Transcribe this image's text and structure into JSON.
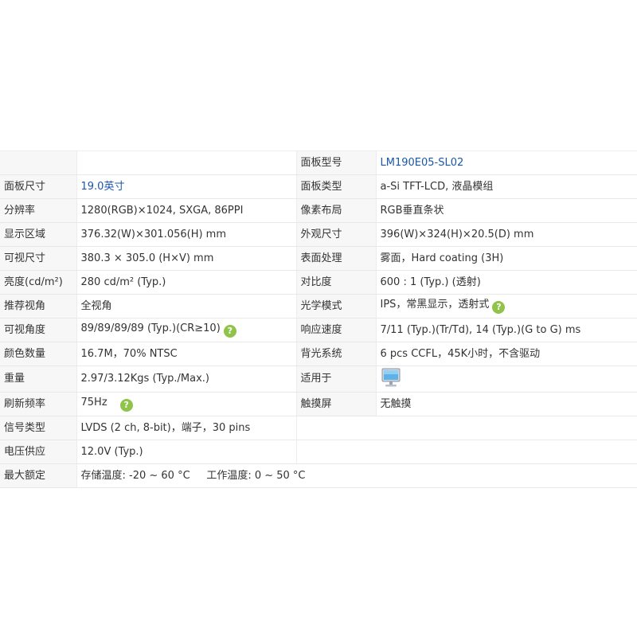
{
  "spec": {
    "model_label": "面板型号",
    "model_value": "LM190E05-SL02",
    "size_label": "面板尺寸",
    "size_value": "19.0英寸",
    "type_label": "面板类型",
    "type_value": "a-Si TFT-LCD, 液晶模组",
    "resolution_label": "分辨率",
    "resolution_value": "1280(RGB)×1024, SXGA, 86PPI",
    "pixel_label": "像素布局",
    "pixel_value": "RGB垂直条状",
    "active_label": "显示区域",
    "active_value": "376.32(W)×301.056(H) mm",
    "outline_label": "外观尺寸",
    "outline_value": "396(W)×324(H)×20.5(D) mm",
    "view_size_label": "可视尺寸",
    "view_size_value": "380.3 × 305.0 (H×V) mm",
    "surface_label": "表面处理",
    "surface_value": "雾面，Hard coating (3H)",
    "brightness_label": "亮度(cd/m²)",
    "brightness_value": "280 cd/m² (Typ.)",
    "contrast_label": "对比度",
    "contrast_value": "600 : 1 (Typ.) (透射)",
    "rec_view_label": "推荐视角",
    "rec_view_value": "全视角",
    "optical_label": "光学模式",
    "optical_value": "IPS，常黑显示，透射式",
    "view_angle_label": "可视角度",
    "view_angle_value": "89/89/89/89 (Typ.)(CR≥10)",
    "response_label": "响应速度",
    "response_value": "7/11 (Typ.)(Tr/Td), 14 (Typ.)(G to G) ms",
    "colors_label": "颜色数量",
    "colors_value": "16.7M，70% NTSC",
    "backlight_label": "背光系统",
    "backlight_value": "6 pcs CCFL，45K小时，不含驱动",
    "weight_label": "重量",
    "weight_value": "2.97/3.12Kgs (Typ./Max.)",
    "application_label": "适用于",
    "application_icon": "monitor-icon",
    "refresh_label": "刷新频率",
    "refresh_value": "75Hz",
    "touch_label": "触摸屏",
    "touch_value": "无触摸",
    "signal_label": "信号类型",
    "signal_value": "LVDS (2 ch, 8-bit)，端子，30 pins",
    "voltage_label": "电压供应",
    "voltage_value": "12.0V (Typ.)",
    "max_label": "最大额定",
    "max_value": "存储温度: -20 ~ 60 °C     工作温度: 0 ~ 50 °C",
    "help_glyph": "?"
  },
  "colors": {
    "link": "#1a57a8",
    "help_icon": "#8fc34a",
    "label_bg": "#f7f7f7"
  }
}
